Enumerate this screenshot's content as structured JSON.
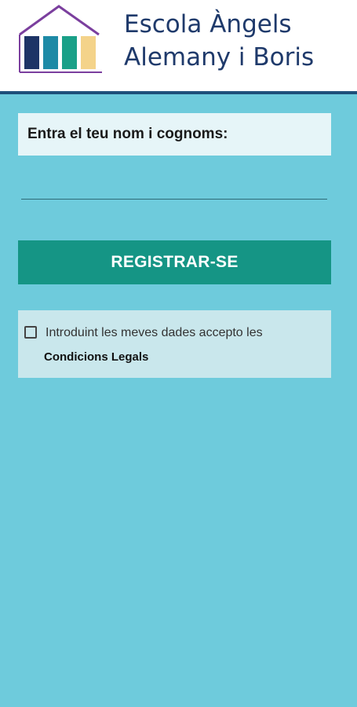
{
  "header": {
    "title_line1": "Escola Àngels",
    "title_line2": "Alemany i Boris"
  },
  "form": {
    "name_prompt": "Entra el teu nom i cognoms:",
    "name_value": "",
    "register_label": "REGISTRAR-SE",
    "legal_text": "Introduint les meves dades accepto les",
    "legal_link": "Condicions Legals",
    "accept_checked": false
  },
  "colors": {
    "background": "#6ecbdc",
    "header_bg": "#ffffff",
    "header_border": "#1e4f7a",
    "title": "#1f3a6b",
    "button": "#159585",
    "prompt_bg": "#e6f5f8",
    "legal_bg": "#c9e7ec",
    "logo_roof": "#7b3f9e",
    "logo_bar1": "#1d3466",
    "logo_bar2": "#1e8aa6",
    "logo_bar3": "#1aa088",
    "logo_bar4": "#f4d38a"
  }
}
